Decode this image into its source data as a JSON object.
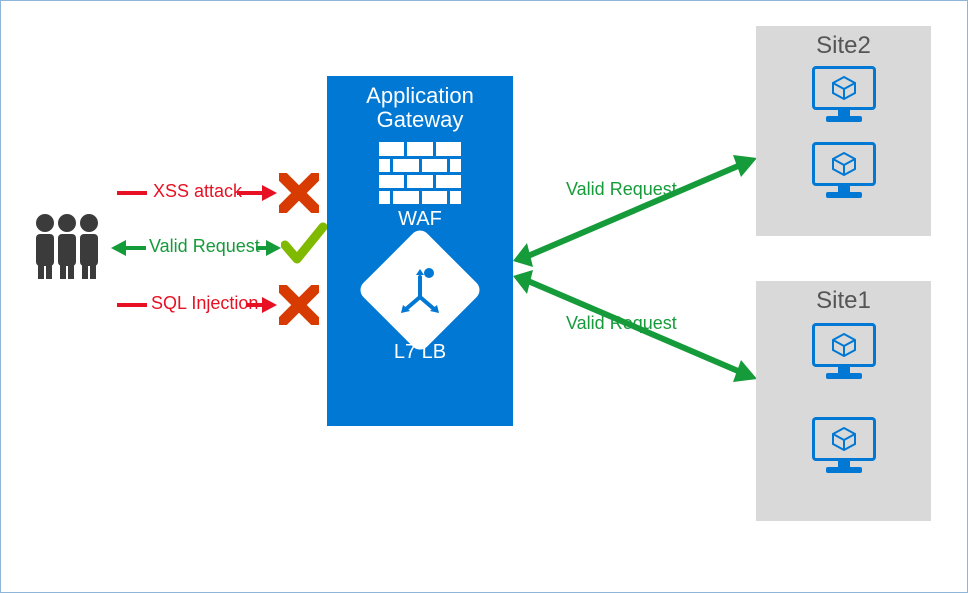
{
  "gateway": {
    "title_line1": "Application",
    "title_line2": "Gateway",
    "waf_label": "WAF",
    "lb_label": "L7 LB"
  },
  "requests": {
    "xss": "XSS attack",
    "valid": "Valid Request",
    "sqli": "SQL Injection",
    "out_site2": "Valid Request",
    "out_site1": "Valid Request"
  },
  "sites": {
    "site2": {
      "title": "Site2"
    },
    "site1": {
      "title": "Site1"
    }
  },
  "colors": {
    "blue": "#0078d4",
    "green": "#169b3a",
    "red": "#e81123",
    "orange_x": "#d83b01",
    "lime_check": "#7fba00",
    "grey_box": "#d9d9d9"
  }
}
